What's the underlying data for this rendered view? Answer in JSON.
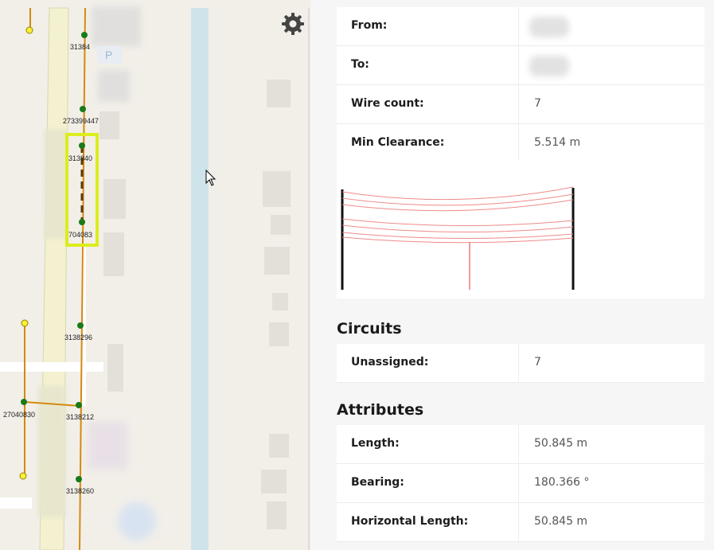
{
  "map": {
    "node_labels": [
      "31384",
      "273399447",
      "313840",
      "704083",
      "3138296",
      "27040830",
      "3138212",
      "3138260"
    ],
    "selection_color": "#dced1c",
    "line_color": "#d4890f",
    "node_color": "#1a7a1a",
    "parking_label": "P",
    "settings_icon": "gear-icon",
    "cursor_icon": "arrow-cursor-icon"
  },
  "details": {
    "rows": [
      {
        "label": "From:",
        "value": ""
      },
      {
        "label": "To:",
        "value": ""
      },
      {
        "label": "Wire count:",
        "value": "7"
      },
      {
        "label": "Min Clearance:",
        "value": "5.514 m"
      }
    ]
  },
  "circuits": {
    "title": "Circuits",
    "rows": [
      {
        "label": "Unassigned:",
        "value": "7"
      }
    ]
  },
  "attributes": {
    "title": "Attributes",
    "rows": [
      {
        "label": "Length:",
        "value": "50.845 m"
      },
      {
        "label": "Bearing:",
        "value": "180.366 °"
      },
      {
        "label": "Horizontal Length:",
        "value": "50.845 m"
      }
    ]
  }
}
